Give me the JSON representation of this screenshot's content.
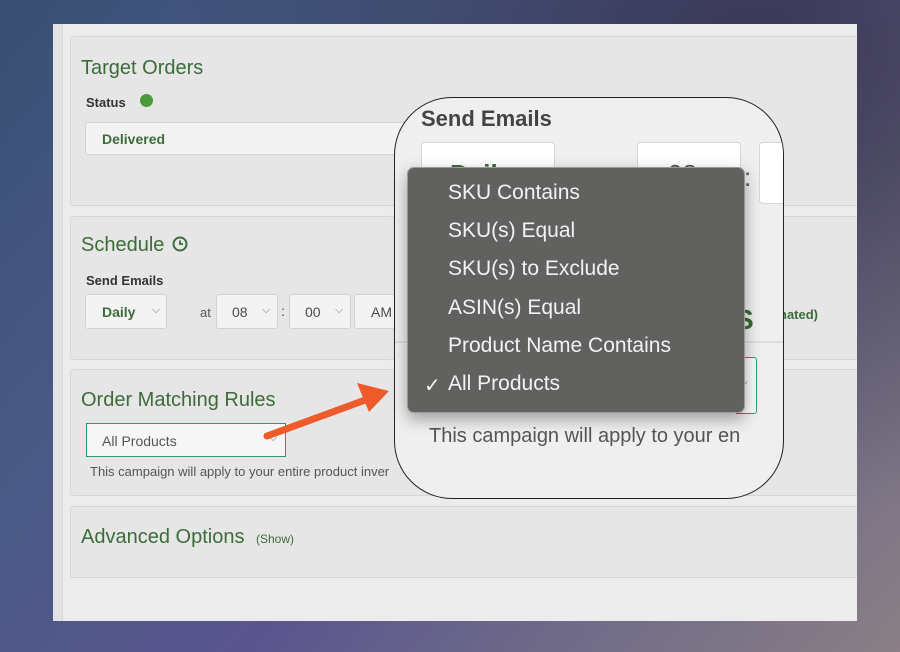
{
  "target_orders": {
    "title": "Target Orders",
    "status_label": "Status",
    "status_value": "Delivered"
  },
  "schedule": {
    "title": "Schedule",
    "send_emails_label": "Send Emails",
    "frequency": "Daily",
    "at_label": "at",
    "hour": "08",
    "colon": ":",
    "minute": "00",
    "ampm": "AM",
    "estimated_fragment": "nated)"
  },
  "order_matching": {
    "title": "Order Matching Rules",
    "selected": "All Products",
    "description": "This campaign will apply to your entire product inver"
  },
  "advanced": {
    "title": "Advanced Options",
    "toggle": "(Show)"
  },
  "zoom": {
    "title": "Send Emails",
    "frequency_partial": "Daily",
    "hour_partial": "08",
    "colon": ":",
    "description": "This campaign will apply to your en"
  },
  "dropdown": {
    "items": [
      "SKU Contains",
      "SKU(s) Equal",
      "SKU(s) to Exclude",
      "ASIN(s) Equal",
      "Product Name Contains",
      "All Products"
    ],
    "selected_index": 5,
    "check_glyph": "✓"
  },
  "colors": {
    "accent_green": "#3d6b3a",
    "status_dot": "#4a9a3a",
    "select_border": "#2e9a74",
    "arrow": "#ee5a2a",
    "menu_bg": "#616160"
  }
}
